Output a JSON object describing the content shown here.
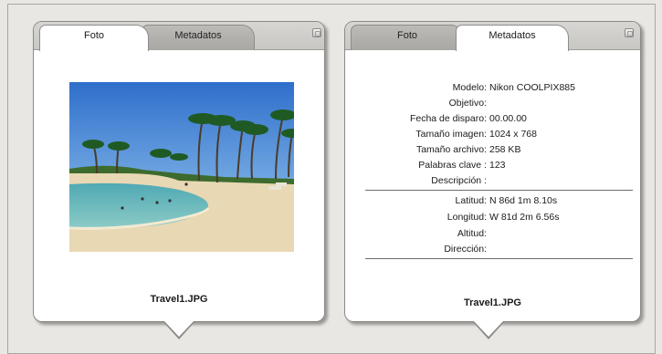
{
  "left_panel": {
    "tabs": [
      {
        "label": "Foto",
        "active": true
      },
      {
        "label": "Metadatos",
        "active": false
      }
    ],
    "photo_icon": "beach-photo",
    "filename": "Travel1.JPG"
  },
  "right_panel": {
    "tabs": [
      {
        "label": "Foto",
        "active": false
      },
      {
        "label": "Metadatos",
        "active": true
      }
    ],
    "metadata_general": [
      {
        "label": "Modelo:",
        "value": "Nikon COOLPIX885"
      },
      {
        "label": "Objetivo:",
        "value": ""
      },
      {
        "label": "Fecha de disparo:",
        "value": "00.00.00"
      },
      {
        "label": "Tamaño imagen:",
        "value": "1024 x 768"
      },
      {
        "label": "Tamaño archivo:",
        "value": "258 KB"
      },
      {
        "label": "Palabras clave :",
        "value": "123"
      },
      {
        "label": "Descripción :",
        "value": ""
      }
    ],
    "metadata_gps": [
      {
        "label": "Latitud:",
        "value": "N 86d 1m 8.10s"
      },
      {
        "label": "Longitud:",
        "value": "W 81d 2m 6.56s"
      },
      {
        "label": "Altitud:",
        "value": ""
      },
      {
        "label": "Dirección:",
        "value": ""
      }
    ],
    "filename": "Travel1.JPG"
  },
  "colors": {
    "background": "#e9e7e3",
    "panel": "#ffffff",
    "tab_inactive": "#b3b1ad"
  }
}
